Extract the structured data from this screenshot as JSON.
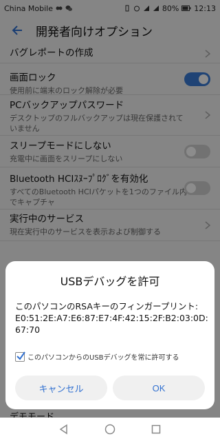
{
  "status_bar": {
    "carrier": "China Mobile",
    "battery": "80%",
    "time": "12:13"
  },
  "app_bar": {
    "title": "開発者向けオプション"
  },
  "settings": [
    {
      "title": "バグレポートの作成",
      "subtitle": "",
      "control": "chevron"
    },
    {
      "title": "画面ロック",
      "subtitle": "使用前に端末のロック解除が必要",
      "control": "toggle-on"
    },
    {
      "title": "PCバックアップパスワード",
      "subtitle": "デスクトップのフルバックアップは現在保護されていません",
      "control": "chevron"
    },
    {
      "title": "スリープモードにしない",
      "subtitle": "充電中に画面をスリープにしない",
      "control": "toggle-off"
    },
    {
      "title": "Bluetooth HCIｽﾇｰﾌﾟﾛｸﾞを有効化",
      "subtitle": "すべてのBluetooth HCIパケットを1つのファイル内でキャプチャ",
      "control": "toggle-off"
    },
    {
      "title": "実行中のサービス",
      "subtitle": "現在実行中のサービスを表示および制御する",
      "control": "chevron"
    }
  ],
  "peek_item": "デモモード",
  "dialog": {
    "title": "USBデバッグを許可",
    "message_line1": "このパソコンのRSAキーのフィンガープリント:",
    "message_line2": "E0:51:2E:A7:E6:87:E7:4F:42:15:2F:B2:03:0D:",
    "message_line3": "67:70",
    "checkbox_label": "このパソコンからのUSBデバッグを常に許可する",
    "checkbox_checked": true,
    "cancel_label": "キャンセル",
    "ok_label": "OK"
  },
  "colors": {
    "accent": "#3a7bd5",
    "button_text": "#2f6fd0"
  },
  "icons": {
    "back": "arrow-left-icon",
    "chevron": "chevron-right-icon",
    "nav_back": "triangle-back-icon",
    "nav_home": "circle-home-icon",
    "nav_recents": "square-recents-icon"
  }
}
